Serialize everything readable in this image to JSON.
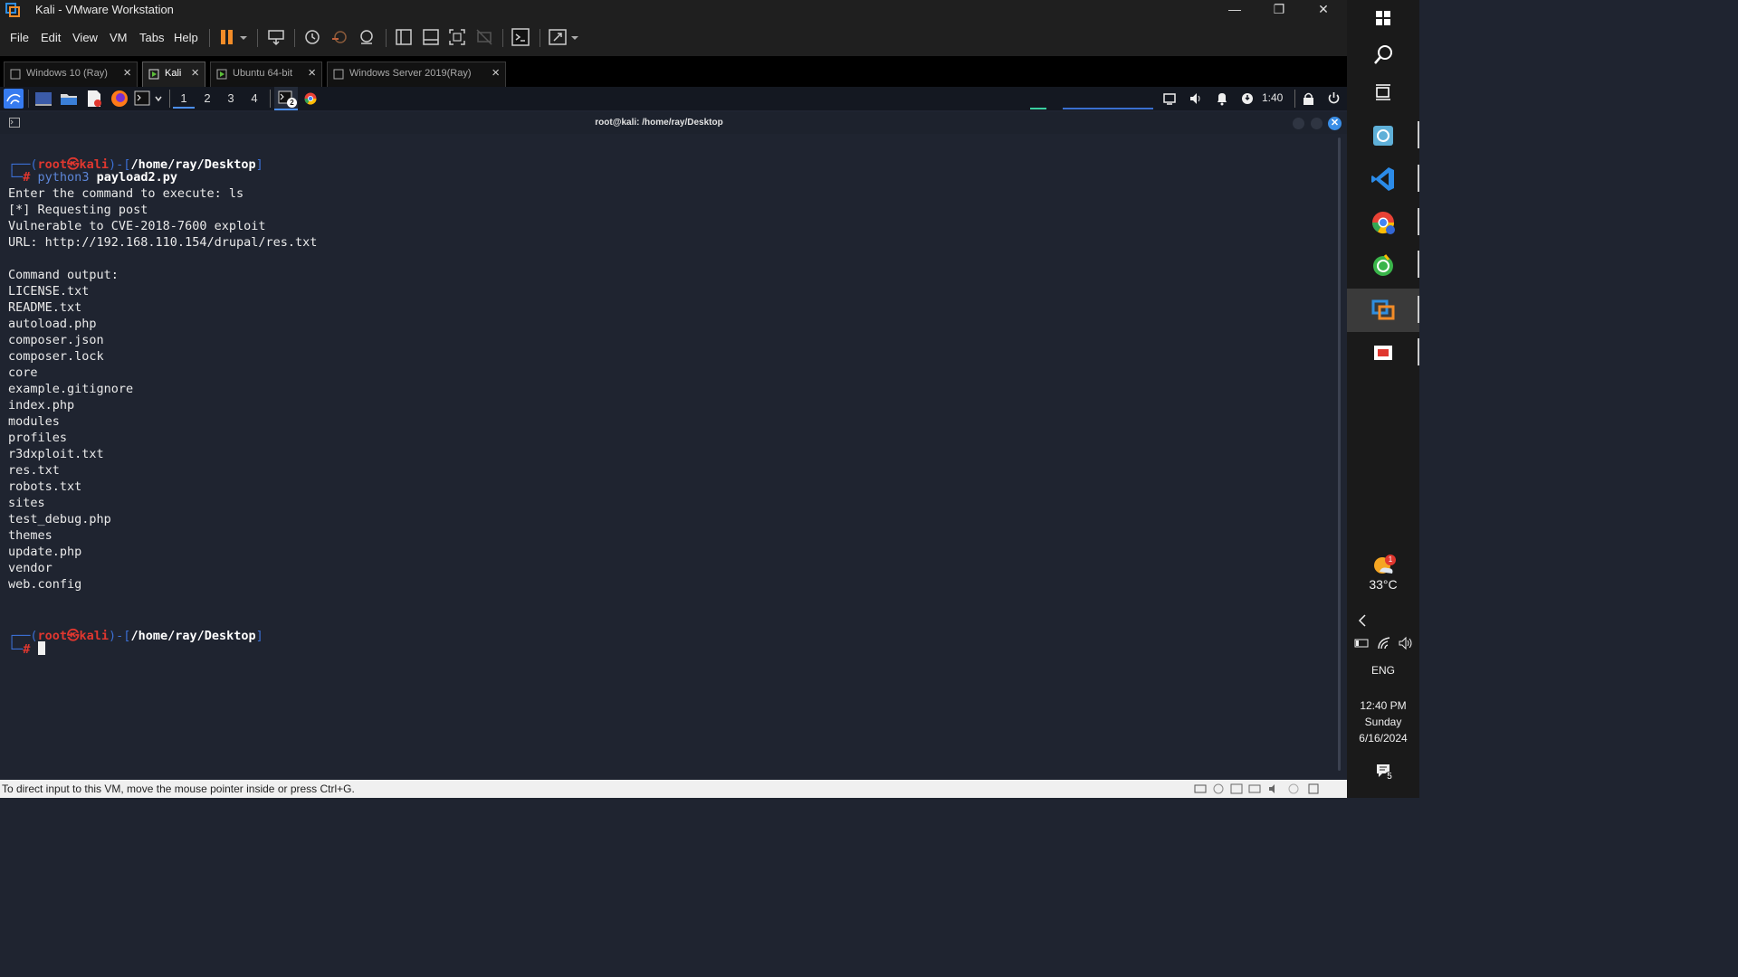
{
  "window": {
    "title": "Kali - VMware Workstation",
    "controls": [
      "minimize-icon",
      "restore-icon",
      "close-icon"
    ]
  },
  "menu": {
    "items": [
      "File",
      "Edit",
      "View",
      "VM",
      "Tabs",
      "Help"
    ],
    "toolbar_icons": [
      "pause-icon",
      "dropdown-icon",
      "send-ctrl-alt-del-icon",
      "snapshot-icon",
      "revert-snapshot-icon",
      "snapshot-manager-icon",
      "library-icon",
      "thumbnail-bar-icon",
      "full-screen-icon",
      "unity-icon",
      "console-view-icon",
      "stretch-guest-icon"
    ]
  },
  "tabs": [
    {
      "label": "Windows 10 (Ray)",
      "active": false
    },
    {
      "label": "Kali",
      "active": true
    },
    {
      "label": "Ubuntu 64-bit",
      "active": false
    },
    {
      "label": "Windows Server 2019(Ray)",
      "active": false
    }
  ],
  "kali_panel": {
    "workspaces": [
      "1",
      "2",
      "3",
      "4"
    ],
    "active_workspace": "1",
    "terminal_badge": "2",
    "clock": "1:40",
    "launcher_icons": [
      "kali-menu-icon",
      "desktop-icon",
      "file-manager-icon",
      "text-editor-icon",
      "firefox-icon",
      "terminal-icon",
      "chevron-down-icon",
      "terminal-window-icon",
      "chrome-icon"
    ],
    "tray_icons": [
      "display-icon",
      "volume-icon",
      "bell-icon",
      "network-icon",
      "lock-icon",
      "power-icon"
    ]
  },
  "terminal": {
    "title": "root@kali: /home/ray/Desktop",
    "prompt": {
      "open": "┌──(",
      "user": "root",
      "at": "㉿",
      "host": "kali",
      "mid": ")-[",
      "path": "/home/ray/Desktop",
      "close": "]",
      "corner": "└─",
      "hash": "#"
    },
    "command_prefix": "python3",
    "command_arg": "payload2.py",
    "output_lines": [
      "Enter the command to execute: ls",
      "[*] Requesting post",
      "Vulnerable to CVE-2018-7600 exploit",
      "URL: http://192.168.110.154/drupal/res.txt",
      "",
      "Command output:",
      "LICENSE.txt",
      "README.txt",
      "autoload.php",
      "composer.json",
      "composer.lock",
      "core",
      "example.gitignore",
      "index.php",
      "modules",
      "profiles",
      "r3dxploit.txt",
      "res.txt",
      "robots.txt",
      "sites",
      "test_debug.php",
      "themes",
      "update.php",
      "vendor",
      "web.config"
    ]
  },
  "statusbar": {
    "text": "To direct input to this VM, move the mouse pointer inside or press Ctrl+G."
  },
  "windows_taskbar": {
    "pinned": [
      "windows-start-icon",
      "search-icon",
      "task-view-icon",
      "app-icon",
      "vscode-icon",
      "chrome-icon",
      "app-icon",
      "vmware-icon",
      "app-icon"
    ],
    "weather": {
      "temp": "33°C",
      "badge": "1"
    },
    "language": "ENG",
    "time": "12:40 PM",
    "day": "Sunday",
    "date": "6/16/2024",
    "notification_count": "5"
  },
  "colors": {
    "terminal_bg": "#1f2430",
    "prompt_blue": "#3b6fd3",
    "prompt_red": "#e0372f",
    "accent_blue": "#4c8ff5",
    "vmware_orange": "#f28c28"
  }
}
